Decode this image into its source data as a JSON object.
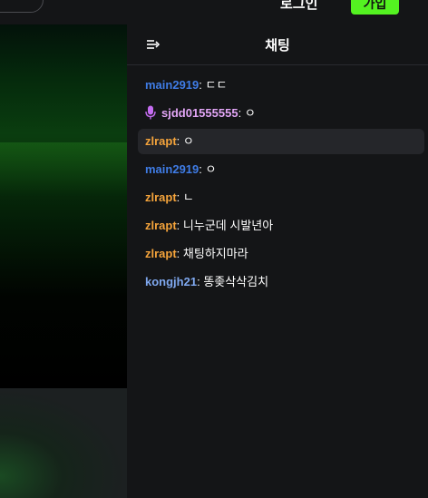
{
  "header": {
    "login_label": "로그인",
    "signup_label": "가입"
  },
  "chat": {
    "title": "채팅",
    "messages": [
      {
        "user": "main2919",
        "text": "ㄷㄷ",
        "color": "#3f7ce6",
        "highlighted": false,
        "badge": null
      },
      {
        "user": "sjdd01555555",
        "text": "ㅇ",
        "color": "#e3a6f7",
        "highlighted": false,
        "badge": "mic-icon"
      },
      {
        "user": "zlrapt",
        "text": "ㅇ",
        "color": "#f4a33b",
        "highlighted": true,
        "badge": null
      },
      {
        "user": "main2919",
        "text": "ㅇ",
        "color": "#3f7ce6",
        "highlighted": false,
        "badge": null
      },
      {
        "user": "zlrapt",
        "text": "ㄴ",
        "color": "#f4a33b",
        "highlighted": false,
        "badge": null
      },
      {
        "user": "zlrapt",
        "text": "니누군데 시발년아",
        "color": "#f4a33b",
        "highlighted": false,
        "badge": null
      },
      {
        "user": "zlrapt",
        "text": "채팅하지마라",
        "color": "#f4a33b",
        "highlighted": false,
        "badge": null
      },
      {
        "user": "kongjh21",
        "text": "똥좆삭삭김치",
        "color": "#7fa8ef",
        "highlighted": false,
        "badge": null
      }
    ]
  },
  "colors": {
    "signup_button": "#54f221",
    "background": "#141517"
  }
}
